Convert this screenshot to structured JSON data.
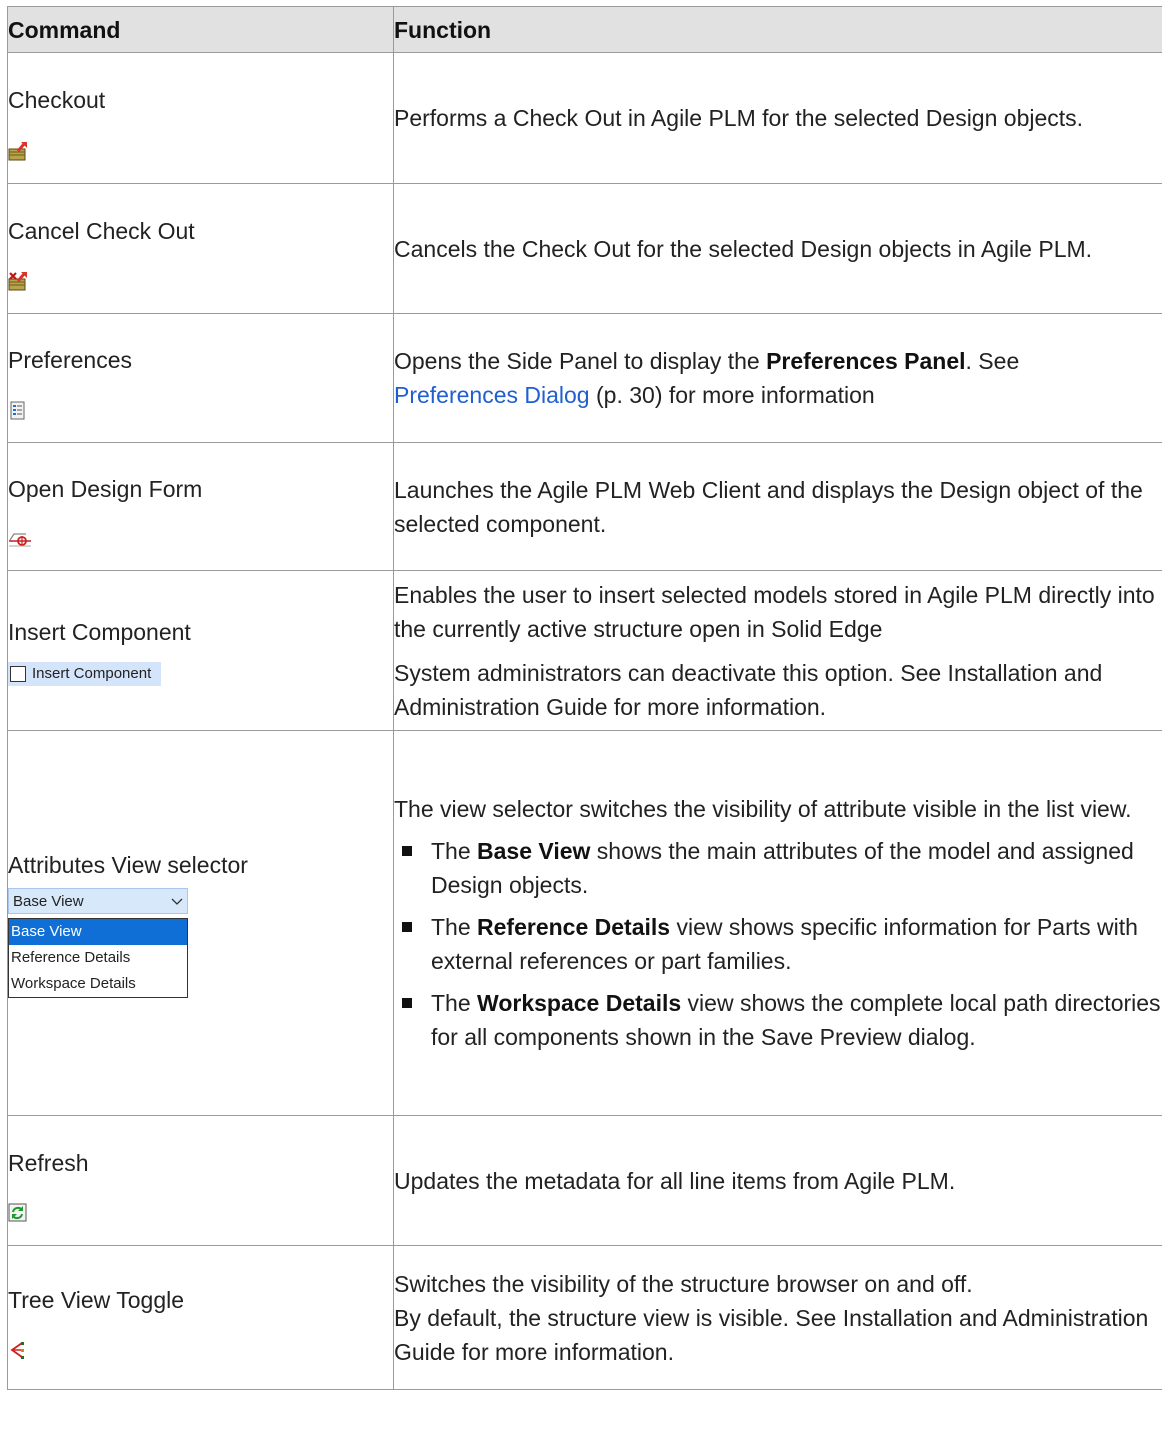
{
  "header": {
    "command": "Command",
    "function": "Function"
  },
  "rows": [
    {
      "command": "Checkout",
      "icon": "checkout-icon",
      "function": "Performs a Check Out in Agile PLM for the selected Design objects."
    },
    {
      "command": "Cancel Check Out",
      "icon": "cancel-checkout-icon",
      "function": "Cancels the Check Out for the selected Design objects in Agile PLM."
    },
    {
      "command": "Preferences",
      "icon": "preferences-icon",
      "function_pre": "Opens the Side Panel to display the ",
      "function_bold": "Preferences Panel",
      "function_mid": ". See ",
      "function_link": "Preferences Dialog",
      "function_post": " (p. 30) for more information"
    },
    {
      "command": "Open Design Form",
      "icon": "design-form-icon",
      "function": "Launches the Agile PLM Web Client and displays the Design object of the selected component."
    },
    {
      "command": "Insert Component",
      "icon": "checkbox-icon",
      "control_label": "Insert Component",
      "function_1": "Enables the user to insert selected models stored in Agile PLM directly into the currently active structure open in Solid Edge",
      "function_2": "System administrators can deactivate this option. See Installation and Administration Guide for more information."
    },
    {
      "command": "Attributes View selector",
      "selector": {
        "selected": "Base View",
        "options": [
          "Base View",
          "Reference Details",
          "Workspace Details"
        ]
      },
      "function_intro": "The view selector switches the visibility of attribute visible in the list view.",
      "bullets": [
        {
          "pre": "The ",
          "bold": "Base View",
          "post": " shows the main attributes of the model and assigned Design objects."
        },
        {
          "pre": "The ",
          "bold": "Reference Details",
          "post": " view shows specific information for Parts with external references or part families."
        },
        {
          "pre": "The ",
          "bold": "Workspace Details",
          "post": " view shows the complete local path directories for all components shown in the Save Preview dialog."
        }
      ]
    },
    {
      "command": "Refresh",
      "icon": "refresh-icon",
      "function": "Updates the metadata for all line items from Agile PLM."
    },
    {
      "command": "Tree View Toggle",
      "icon": "tree-view-icon",
      "function_1": "Switches the visibility of the structure browser on and off.",
      "function_2": "By default, the structure view is visible. See Installation and Administration Guide for more information."
    }
  ]
}
